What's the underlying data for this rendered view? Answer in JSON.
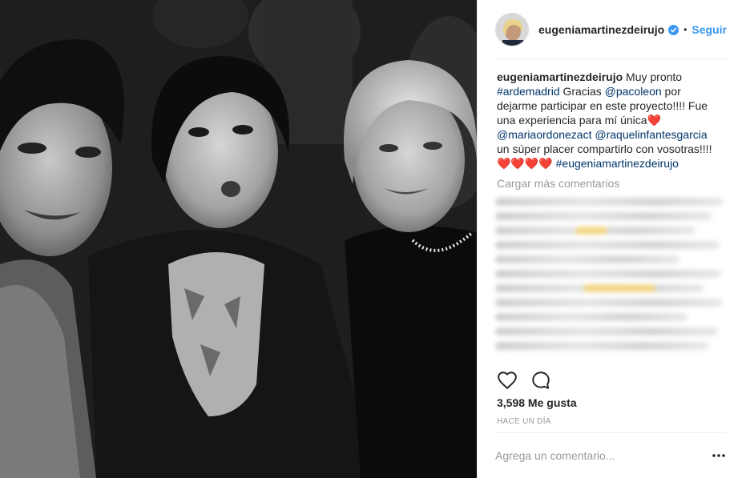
{
  "post": {
    "username": "eugeniamartinezdeirujo",
    "verified_icon": "verified-badge-icon",
    "separator": "•",
    "follow_label": "Seguir",
    "caption": {
      "line1_user": "eugeniamartinezdeirujo",
      "line1_text": " Muy pronto",
      "line2_hashtag": "#ardemadrid",
      "line2_text": " Gracias ",
      "line2_mention": "@pacoleon",
      "line2_end": " por",
      "line3_text": "dejarme participar en este proyecto!!!! Fue",
      "line4_text": "una experiencia para mí única",
      "line5_mention1": "@mariaordonezact",
      "line5_mention2": "@raquelinfantesgarcia",
      "line6_text": "un súper placer compartirlo con vosotras!!!!",
      "line7_hearts": "❤️❤️❤️❤️",
      "line7_hashtag": "#eugeniamartinezdeirujo",
      "heart": "❤️"
    },
    "load_more_label": "Cargar más comentarios",
    "likes": "3,598 Me gusta",
    "timestamp": "HACE UN DÍA",
    "comment_placeholder": "Agrega un comentario...",
    "icons": {
      "like": "heart-outline-icon",
      "comment": "comment-bubble-icon",
      "more": "more-options-icon"
    },
    "colors": {
      "accent": "#3897f0",
      "link": "#003569",
      "muted": "#999999",
      "heart": "#e0242a",
      "text": "#262626"
    }
  }
}
